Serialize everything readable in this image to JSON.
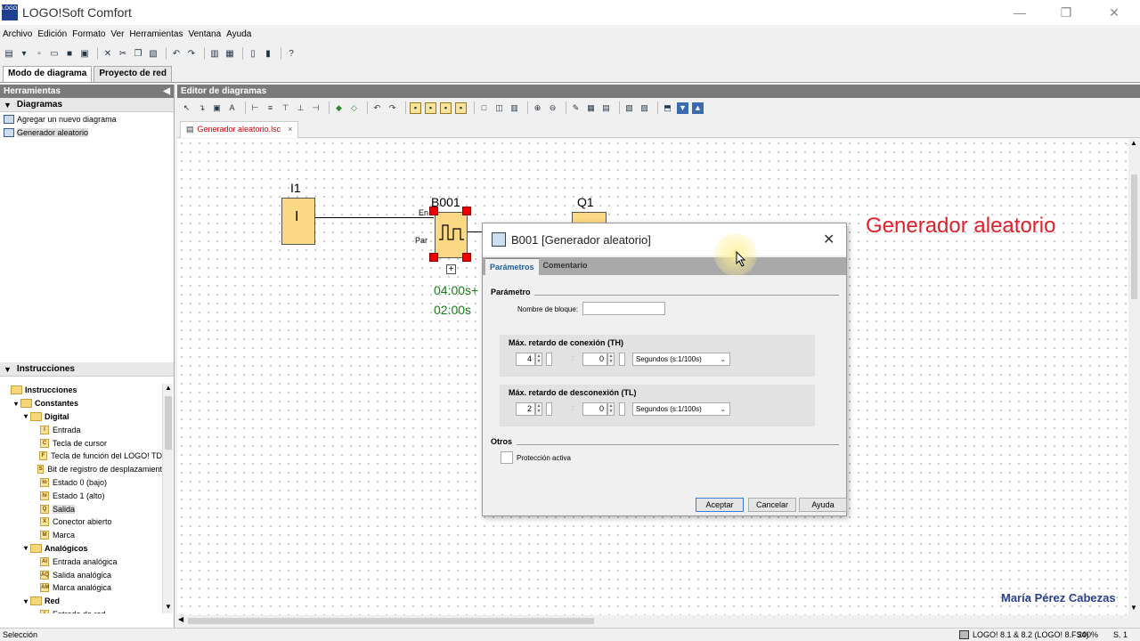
{
  "window": {
    "title": "LOGO!Soft Comfort",
    "logo_text": "LOGO!",
    "minimize": "—",
    "maximize": "❐",
    "close": "✕"
  },
  "menu": [
    "Archivo",
    "Edición",
    "Formato",
    "Ver",
    "Herramientas",
    "Ventana",
    "Ayuda"
  ],
  "mode_tabs": [
    "Modo de diagrama",
    "Proyecto de red"
  ],
  "left_panel": {
    "title": "Herramientas",
    "diagrams_title": "Diagramas",
    "diagrams": [
      "Agregar un nuevo diagrama",
      "Generador aleatorio"
    ],
    "instructions_title": "Instrucciones",
    "tree": [
      {
        "label": "Instrucciones",
        "level": 0,
        "kind": "folder",
        "bold": true
      },
      {
        "label": "Constantes",
        "level": 1,
        "kind": "folder",
        "bold": true
      },
      {
        "label": "Digital",
        "level": 2,
        "kind": "folder",
        "bold": true
      },
      {
        "label": "Entrada",
        "level": 3,
        "kind": "block",
        "glyph": "I"
      },
      {
        "label": "Tecla de cursor",
        "level": 3,
        "kind": "block",
        "glyph": "C"
      },
      {
        "label": "Tecla de función del LOGO! TD",
        "level": 3,
        "kind": "block",
        "glyph": "F"
      },
      {
        "label": "Bit de registro de desplazamient",
        "level": 3,
        "kind": "block",
        "glyph": "S"
      },
      {
        "label": "Estado 0 (bajo)",
        "level": 3,
        "kind": "block",
        "glyph": "lo"
      },
      {
        "label": "Estado 1 (alto)",
        "level": 3,
        "kind": "block",
        "glyph": "hi"
      },
      {
        "label": "Salida",
        "level": 3,
        "kind": "block",
        "glyph": "Q"
      },
      {
        "label": "Conector abierto",
        "level": 3,
        "kind": "block",
        "glyph": "X"
      },
      {
        "label": "Marca",
        "level": 3,
        "kind": "block",
        "glyph": "M"
      },
      {
        "label": "Analógicos",
        "level": 2,
        "kind": "folder",
        "bold": true
      },
      {
        "label": "Entrada analógica",
        "level": 3,
        "kind": "block",
        "glyph": "AI"
      },
      {
        "label": "Salida analógica",
        "level": 3,
        "kind": "block",
        "glyph": "AQ"
      },
      {
        "label": "Marca analógica",
        "level": 3,
        "kind": "block",
        "glyph": "AM"
      },
      {
        "label": "Red",
        "level": 2,
        "kind": "folder",
        "bold": true
      },
      {
        "label": "Entrada de red",
        "level": 3,
        "kind": "block",
        "glyph": "I"
      }
    ]
  },
  "editor": {
    "title": "Editor de diagramas",
    "doc_tab": "Generador aleatorio.lsc",
    "doc_tab_close": "×"
  },
  "canvas": {
    "input_label": "I1",
    "input_text": "I",
    "block_label": "B001",
    "output_label": "Q1",
    "pin_en": "En",
    "pin_par": "Par",
    "expand": "+",
    "param_on": "04:00s+",
    "param_off": "02:00s"
  },
  "overlay": {
    "title": "Generador aleatorio",
    "author": "María Pérez Cabezas"
  },
  "dialog": {
    "title": "B001 [Generador aleatorio]",
    "close": "✕",
    "tabs": [
      "Parámetros",
      "Comentario"
    ],
    "param_group": "Parámetro",
    "block_name_label": "Nombre de bloque:",
    "block_name_value": "",
    "th_title": "Máx. retardo de conexión (TH)",
    "th_value1": "4",
    "th_value2": "0",
    "th_unit": "Segundos (s:1/100s)",
    "tl_title": "Máx. retardo de desconexión (TL)",
    "tl_value1": "2",
    "tl_value2": "0",
    "tl_unit": "Segundos (s:1/100s)",
    "colon": ":",
    "others_group": "Otros",
    "protection_label": "Protección activa",
    "protection_checked": false,
    "buttons": {
      "ok": "Aceptar",
      "cancel": "Cancelar",
      "help": "Ayuda"
    }
  },
  "status": {
    "left": "Selección",
    "version": "LOGO! 8.1 & 8.2 (LOGO! 8.FS4)",
    "zoom": "200%",
    "page": "S. 1"
  }
}
